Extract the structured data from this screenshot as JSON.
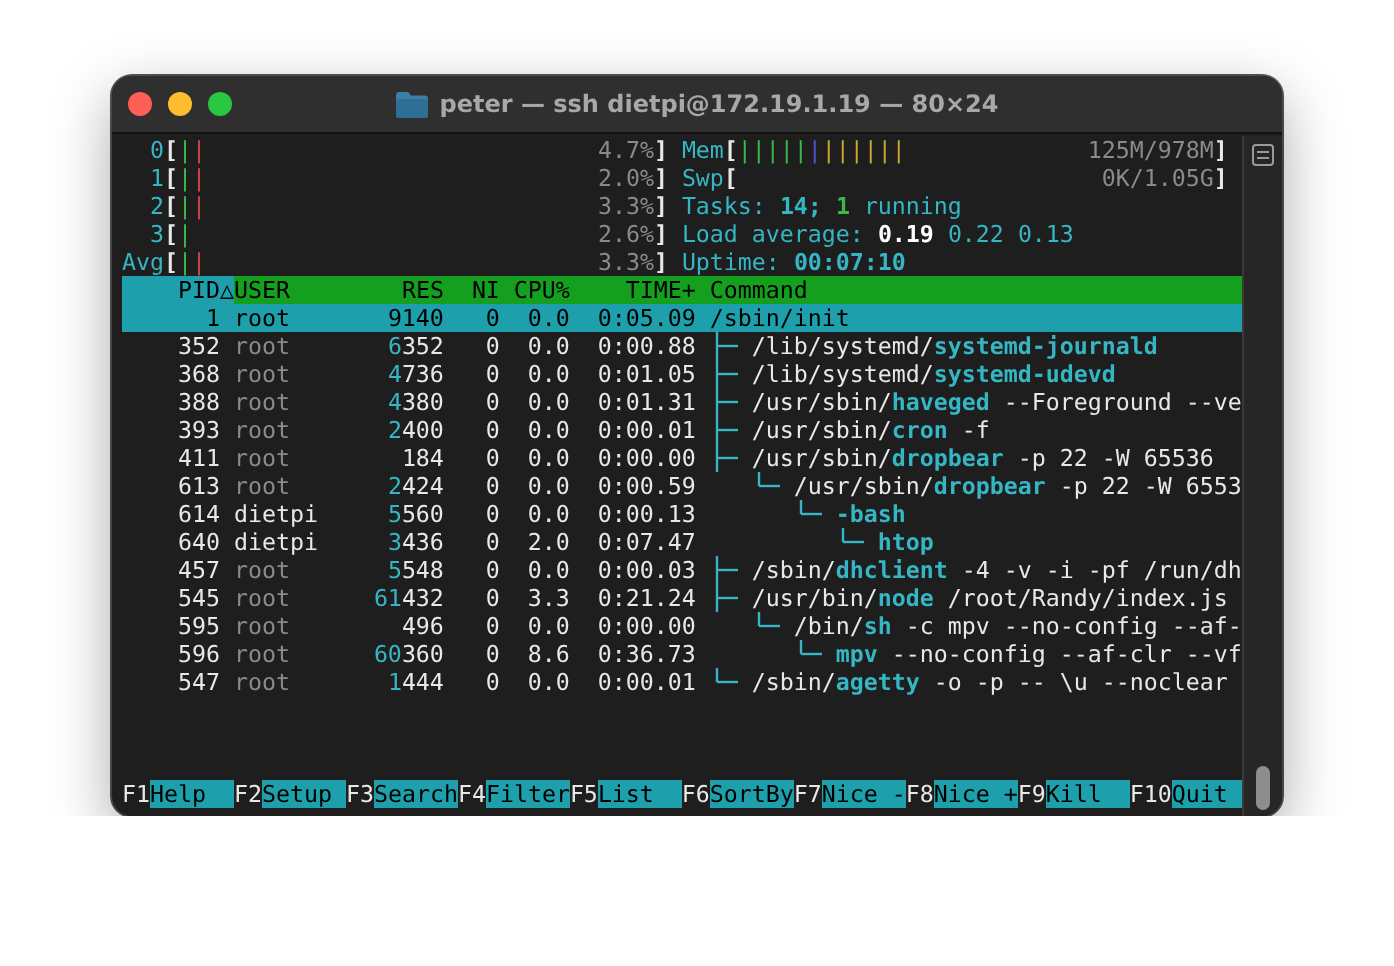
{
  "window": {
    "title": "peter — ssh dietpi@172.19.1.19 — 80×24"
  },
  "cpu_meters": [
    {
      "label": "0",
      "open": "[",
      "segments": [
        {
          "color": "#3cb84a",
          "bars": "|"
        },
        {
          "color": "#c8473c",
          "bars": "|"
        }
      ],
      "reading": "4.7%",
      "close": "]"
    },
    {
      "label": "1",
      "open": "[",
      "segments": [
        {
          "color": "#3cb84a",
          "bars": "|"
        },
        {
          "color": "#c8473c",
          "bars": "|"
        }
      ],
      "reading": "2.0%",
      "close": "]"
    },
    {
      "label": "2",
      "open": "[",
      "segments": [
        {
          "color": "#3cb84a",
          "bars": "|"
        },
        {
          "color": "#c8473c",
          "bars": "|"
        }
      ],
      "reading": "3.3%",
      "close": "]"
    },
    {
      "label": "3",
      "open": "[",
      "segments": [
        {
          "color": "#3cb84a",
          "bars": "|"
        }
      ],
      "reading": "2.6%",
      "close": "]"
    },
    {
      "label": "Avg",
      "open": "[",
      "segments": [
        {
          "color": "#3cb84a",
          "bars": "|"
        },
        {
          "color": "#c8473c",
          "bars": "|"
        }
      ],
      "reading": "3.3%",
      "close": "]"
    }
  ],
  "memory_meters": [
    {
      "label": "Mem",
      "open": "[",
      "segments": [
        {
          "color": "#3cb84a",
          "bars": "|||||"
        },
        {
          "color": "#5a4fd0",
          "bars": "|"
        },
        {
          "color": "#c9a634",
          "bars": "||||||"
        }
      ],
      "reading": "125M/978M",
      "close": "]"
    },
    {
      "label": "Swp",
      "open": "[",
      "reading": "0K/1.05G",
      "close": "]"
    }
  ],
  "tasks": {
    "label": "Tasks:",
    "count": "14;",
    "running": "1",
    "running_label": "running"
  },
  "load_average": {
    "label": "Load average:",
    "values": [
      "0.19",
      "0.22",
      "0.13"
    ]
  },
  "uptime": {
    "label": "Uptime:",
    "value": "00:07:10"
  },
  "table": {
    "columns": [
      {
        "label": "PID",
        "sorted": true,
        "sort_indicator": "△"
      },
      {
        "label": "USER",
        "sorted": false
      },
      {
        "label": "RES",
        "sorted": false
      },
      {
        "label": "NI",
        "sorted": false
      },
      {
        "label": "CPU%",
        "sorted": false
      },
      {
        "label": "TIME+",
        "sorted": false
      },
      {
        "label": "Command",
        "sorted": false
      }
    ],
    "processes": [
      {
        "pid": "1",
        "user": "root",
        "res": "9140",
        "ni": "0",
        "cpu": "0.0",
        "time": "0:05.09",
        "selected": true,
        "command": {
          "path": "/sbin/",
          "name": "init"
        },
        "children": [
          {
            "pid": "352",
            "user": "root",
            "user_dimmed": true,
            "res": "6352",
            "ni": "0",
            "cpu": "0.0",
            "time": "0:00.88",
            "selected": false,
            "command": {
              "path": "/lib/systemd/",
              "name": "systemd-journald"
            }
          },
          {
            "pid": "368",
            "user": "root",
            "user_dimmed": true,
            "res": "4736",
            "ni": "0",
            "cpu": "0.0",
            "time": "0:01.05",
            "selected": false,
            "command": {
              "path": "/lib/systemd/",
              "name": "systemd-udevd"
            }
          },
          {
            "pid": "388",
            "user": "root",
            "user_dimmed": true,
            "res": "4380",
            "ni": "0",
            "cpu": "0.0",
            "time": "0:01.31",
            "selected": false,
            "command": {
              "path": "/usr/sbin/",
              "name": "haveged",
              "args": "--Foreground --ve"
            }
          },
          {
            "pid": "393",
            "user": "root",
            "user_dimmed": true,
            "res": "2400",
            "ni": "0",
            "cpu": "0.0",
            "time": "0:00.01",
            "selected": false,
            "command": {
              "path": "/usr/sbin/",
              "name": "cron",
              "args": "-f"
            }
          },
          {
            "pid": "411",
            "user": "root",
            "user_dimmed": true,
            "res": "184",
            "ni": "0",
            "cpu": "0.0",
            "time": "0:00.00",
            "selected": false,
            "command": {
              "path": "/usr/sbin/",
              "name": "dropbear",
              "args": "-p 22 -W 65536"
            },
            "children": [
              {
                "pid": "613",
                "user": "root",
                "user_dimmed": true,
                "res": "2424",
                "ni": "0",
                "cpu": "0.0",
                "time": "0:00.59",
                "selected": false,
                "command": {
                  "path": "/usr/sbin/",
                  "name": "dropbear",
                  "args": "-p 22 -W 6553"
                },
                "children": [
                  {
                    "pid": "614",
                    "user": "dietpi",
                    "user_dimmed": false,
                    "res": "5560",
                    "ni": "0",
                    "cpu": "0.0",
                    "time": "0:00.13",
                    "selected": false,
                    "command": {
                      "name": "-bash"
                    },
                    "children": [
                      {
                        "pid": "640",
                        "user": "dietpi",
                        "user_dimmed": false,
                        "res": "3436",
                        "ni": "0",
                        "cpu": "2.0",
                        "time": "0:07.47",
                        "selected": false,
                        "command": {
                          "name": "htop"
                        }
                      }
                    ]
                  }
                ]
              }
            ]
          },
          {
            "pid": "457",
            "user": "root",
            "user_dimmed": true,
            "res": "5548",
            "ni": "0",
            "cpu": "0.0",
            "time": "0:00.03",
            "selected": false,
            "command": {
              "path": "/sbin/",
              "name": "dhclient",
              "args": "-4 -v -i -pf /run/dh"
            }
          },
          {
            "pid": "545",
            "user": "root",
            "user_dimmed": true,
            "res": "61432",
            "ni": "0",
            "cpu": "3.3",
            "time": "0:21.24",
            "selected": false,
            "command": {
              "path": "/usr/bin/",
              "name": "node",
              "args": "/root/Randy/index.js"
            },
            "children": [
              {
                "pid": "595",
                "user": "root",
                "user_dimmed": true,
                "res": "496",
                "ni": "0",
                "cpu": "0.0",
                "time": "0:00.00",
                "selected": false,
                "command": {
                  "path": "/bin/",
                  "name": "sh",
                  "args": "-c mpv --no-config --af-"
                },
                "children": [
                  {
                    "pid": "596",
                    "user": "root",
                    "user_dimmed": true,
                    "res": "60360",
                    "ni": "0",
                    "cpu": "8.6",
                    "time": "0:36.73",
                    "selected": false,
                    "command": {
                      "name": "mpv",
                      "args": "--no-config --af-clr --vf"
                    }
                  }
                ]
              }
            ]
          },
          {
            "pid": "547",
            "user": "root",
            "user_dimmed": true,
            "res": "1444",
            "ni": "0",
            "cpu": "0.0",
            "time": "0:00.01",
            "selected": false,
            "command": {
              "path": "/sbin/",
              "name": "agetty",
              "args": "-o -p -- \\u --noclear"
            }
          }
        ]
      }
    ]
  },
  "function_keys": [
    {
      "key": "F1",
      "label": "Help"
    },
    {
      "key": "F2",
      "label": "Setup"
    },
    {
      "key": "F3",
      "label": "Search"
    },
    {
      "key": "F4",
      "label": "Filter"
    },
    {
      "key": "F5",
      "label": "List"
    },
    {
      "key": "F6",
      "label": "SortBy"
    },
    {
      "key": "F7",
      "label": "Nice -"
    },
    {
      "key": "F8",
      "label": "Nice +"
    },
    {
      "key": "F9",
      "label": "Kill"
    },
    {
      "key": "F10",
      "label": "Quit"
    }
  ]
}
